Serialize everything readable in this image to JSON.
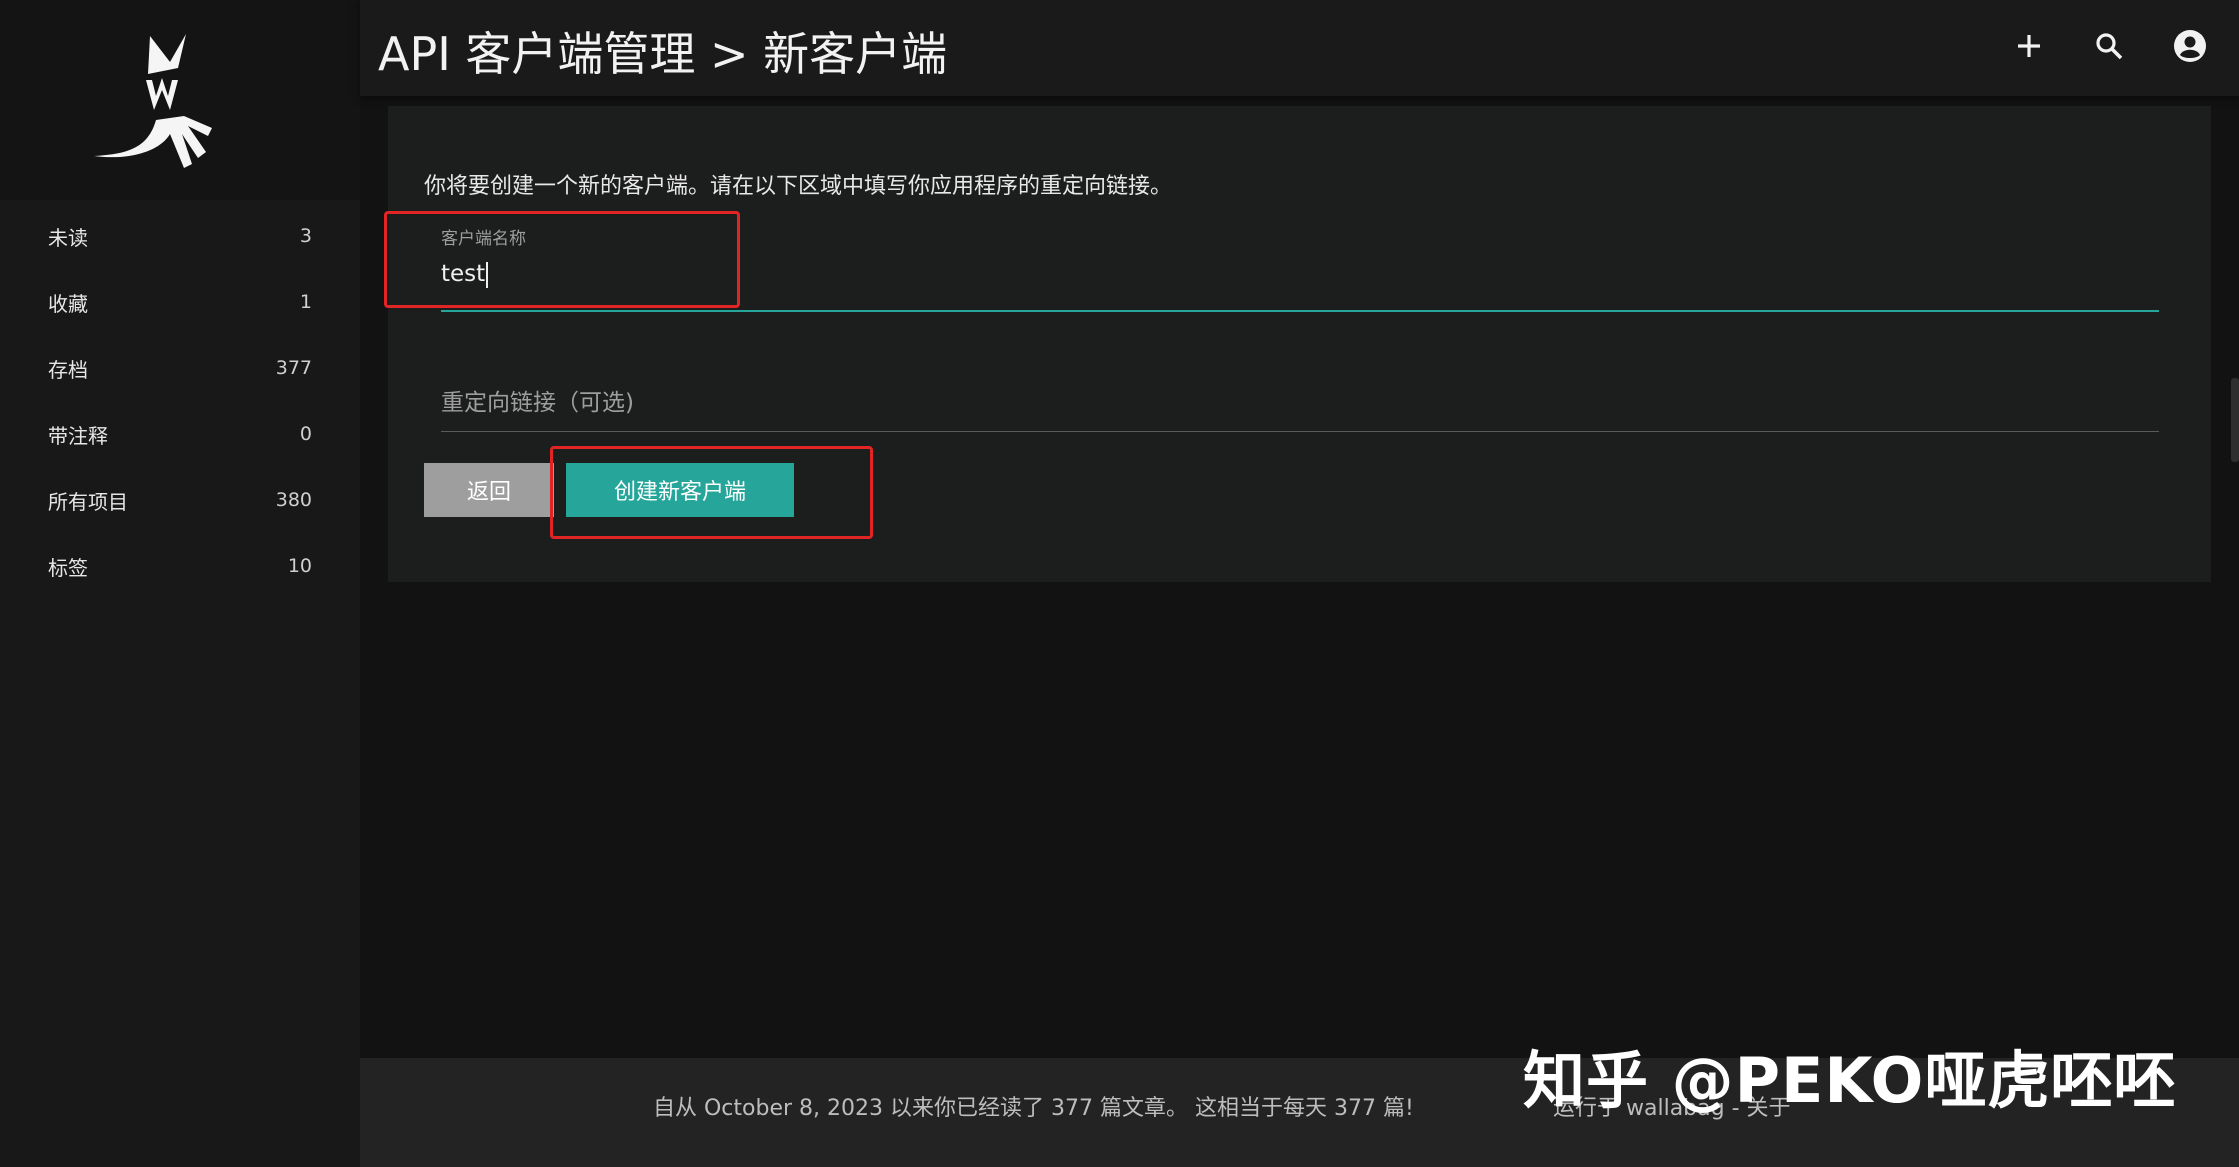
{
  "topbar": {
    "title": "API 客户端管理 > 新客户端",
    "icons": [
      "add-icon",
      "search-icon",
      "account-icon"
    ]
  },
  "sidebar": {
    "items": [
      {
        "label": "未读",
        "count": "3"
      },
      {
        "label": "收藏",
        "count": "1"
      },
      {
        "label": "存档",
        "count": "377"
      },
      {
        "label": "带注释",
        "count": "0"
      },
      {
        "label": "所有项目",
        "count": "380"
      },
      {
        "label": "标签",
        "count": "10"
      }
    ]
  },
  "form": {
    "intro": "你将要创建一个新的客户端。请在以下区域中填写你应用程序的重定向链接。",
    "client_name_label": "客户端名称",
    "client_name_value": "test",
    "redirect_label": "重定向链接（可选)",
    "back_label": "返回",
    "create_label": "创建新客户端"
  },
  "footer": {
    "stats": "自从 October 8, 2023 以来你已经读了 377 篇文章。 这相当于每天 377 篇!",
    "powered": "运行于 wallabag - 关于"
  },
  "watermark": "知乎 @PEKO哑虎呸呸",
  "colors": {
    "accent": "#26a69a",
    "annotation": "#e12525",
    "back_button": "#9e9e9e"
  }
}
